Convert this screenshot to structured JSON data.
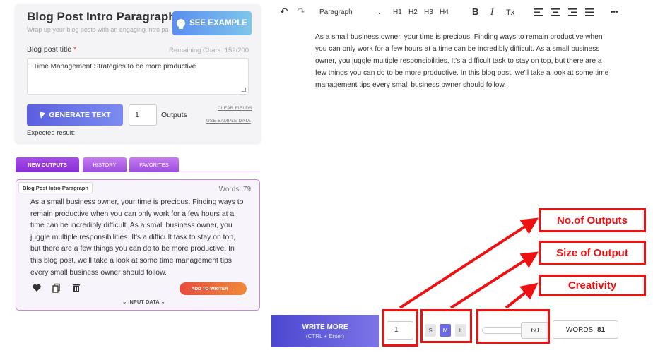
{
  "form": {
    "title": "Blog Post Intro Paragraph",
    "subtitle": "Wrap up your blog posts with an engaging intro pa",
    "see_example_label": "SEE EXAMPLE",
    "field_label": "Blog post title",
    "required_mark": "*",
    "remaining": "Remaining Chars: 152/200",
    "field_value": "Time Management Strategies to be more productive",
    "generate_label": "GENERATE TEXT",
    "outputs_value": "1",
    "outputs_label": "Outputs",
    "clear_fields": "CLEAR FIELDS",
    "use_sample": "USE SAMPLE DATA",
    "expected": "Expected result:"
  },
  "tabs": [
    "NEW OUTPUTS",
    "HISTORY",
    "FAVORITES"
  ],
  "output": {
    "badge": "Blog Post Intro Paragraph",
    "words": "Words: 79",
    "text": "As a small business owner, your time is precious. Finding ways to remain productive when you can only work for a few hours at a time can be incredibly difficult. As a small business owner, you juggle multiple responsibilities. It's a difficult task to stay on top, but there are a few things you can do to be more productive. In this blog post, we'll take a look at some time management tips every small business owner should follow.",
    "add_to_writer": "ADD TO WRITER",
    "input_data": "INPUT DATA"
  },
  "toolbar": {
    "undo": "↶",
    "redo": "↷",
    "paragraph": "Paragraph",
    "h1": "H1",
    "h2": "H2",
    "h3": "H3",
    "h4": "H4",
    "bold": "B",
    "italic": "I",
    "clear_format": "Tx",
    "more": "•••"
  },
  "editor": {
    "text": "As a small business owner, your time is precious. Finding ways to remain productive when you can only work for a few hours at a time can be incredibly difficult. As a small business owner, you juggle multiple responsibilities. It's a difficult task to stay on top, but there are a few things you can do to be more productive. In this blog post, we'll take a look at some time management tips every small business owner should follow."
  },
  "bottom": {
    "write_more": "WRITE MORE",
    "write_more_hint": "(CTRL + Enter)",
    "outputs_value": "1",
    "sizes": [
      "S",
      "M",
      "L"
    ],
    "selected_size": "M",
    "creativity_value": "60",
    "words_label": "WORDS:",
    "words_count": "81"
  },
  "callouts": {
    "outputs": "No.of Outputs",
    "size": "Size of Output",
    "creativity": "Creativity"
  },
  "colors": {
    "accent": "#6c6ae0",
    "callout": "#ee1111"
  }
}
